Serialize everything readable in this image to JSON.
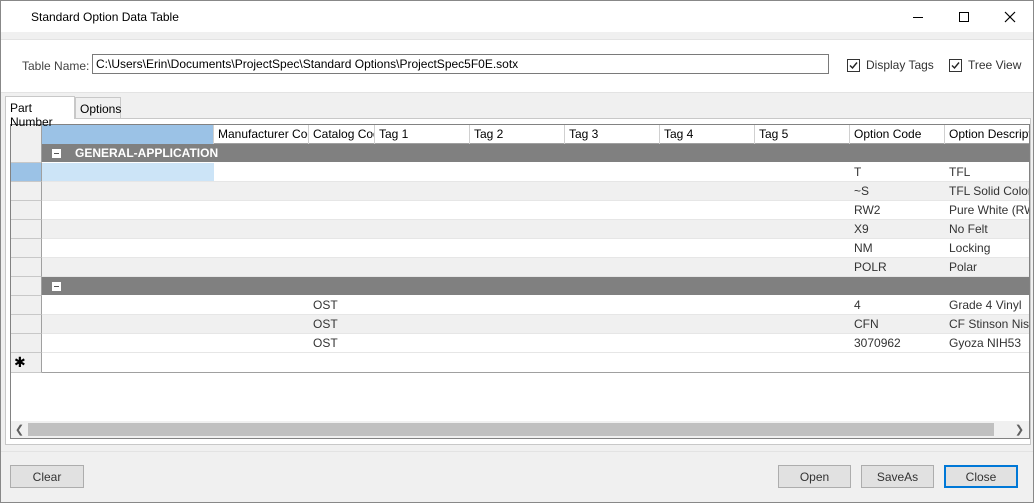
{
  "window": {
    "title": "Standard Option Data Table",
    "minimize_icon": "minimize-icon",
    "maximize_icon": "maximize-icon",
    "close_icon": "close-icon"
  },
  "table_name": {
    "label": "Table Name:",
    "value": "C:\\Users\\Erin\\Documents\\ProjectSpec\\Standard Options\\ProjectSpec5F0E.sotx"
  },
  "options": {
    "display_tags": {
      "label": "Display Tags",
      "checked": true
    },
    "tree_view": {
      "label": "Tree View",
      "checked": true
    }
  },
  "tabs": [
    {
      "label": "Part Number",
      "active": true
    },
    {
      "label": "Options",
      "active": false
    }
  ],
  "grid": {
    "columns": [
      "Manufacturer Code",
      "Catalog Code",
      "Tag 1",
      "Tag 2",
      "Tag 3",
      "Tag 4",
      "Tag 5",
      "Option Code",
      "Option Description"
    ],
    "groups": [
      {
        "name": "GENERAL-APPLICATION",
        "rows": [
          {
            "catalog": "",
            "option_code": "T",
            "description": "TFL"
          },
          {
            "catalog": "",
            "option_code": "~S",
            "description": "TFL Solid Color"
          },
          {
            "catalog": "",
            "option_code": "RW2",
            "description": "Pure White (RW"
          },
          {
            "catalog": "",
            "option_code": "X9",
            "description": "No Felt"
          },
          {
            "catalog": "",
            "option_code": "NM",
            "description": "Locking"
          },
          {
            "catalog": "",
            "option_code": "POLR",
            "description": "Polar"
          }
        ]
      },
      {
        "name": "",
        "rows": [
          {
            "catalog": "OST",
            "option_code": "4",
            "description": "Grade 4 Vinyl"
          },
          {
            "catalog": "OST",
            "option_code": "CFN",
            "description": "CF Stinson Nishi"
          },
          {
            "catalog": "OST",
            "option_code": "3070962",
            "description": "Gyoza NIH53"
          }
        ]
      }
    ],
    "new_row_marker": "✱"
  },
  "buttons": {
    "clear": "Clear",
    "open": "Open",
    "save_as": "SaveAs",
    "close": "Close"
  },
  "colors": {
    "group_header": "#808080",
    "selection": "#9bc2e6",
    "default_button_border": "#0078d7"
  }
}
